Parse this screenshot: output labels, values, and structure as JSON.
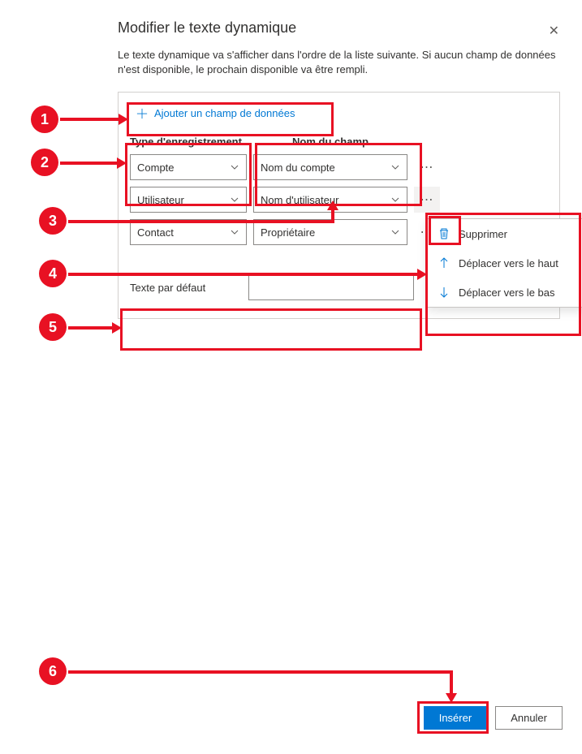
{
  "dialog": {
    "title": "Modifier le texte dynamique",
    "description": "Le texte dynamique va s'afficher dans l'ordre de la liste suivante. Si aucun champ de données n'est disponible, le prochain disponible va être rempli."
  },
  "add_button_label": "Ajouter un champ de données",
  "columns": {
    "type_label": "Type d'enregistrement",
    "field_label": "Nom du champ"
  },
  "rows": [
    {
      "type": "Compte",
      "field": "Nom du compte"
    },
    {
      "type": "Utilisateur",
      "field": "Nom d'utilisateur"
    },
    {
      "type": "Contact",
      "field": "Propriétaire"
    }
  ],
  "default_text": {
    "label": "Texte par défaut",
    "value": ""
  },
  "context_menu": {
    "delete": "Supprimer",
    "move_up": "Déplacer vers le haut",
    "move_down": "Déplacer vers le bas"
  },
  "footer": {
    "insert": "Insérer",
    "cancel": "Annuler"
  },
  "annotations": {
    "n1": "1",
    "n2": "2",
    "n3": "3",
    "n4": "4",
    "n5": "5",
    "n6": "6"
  }
}
